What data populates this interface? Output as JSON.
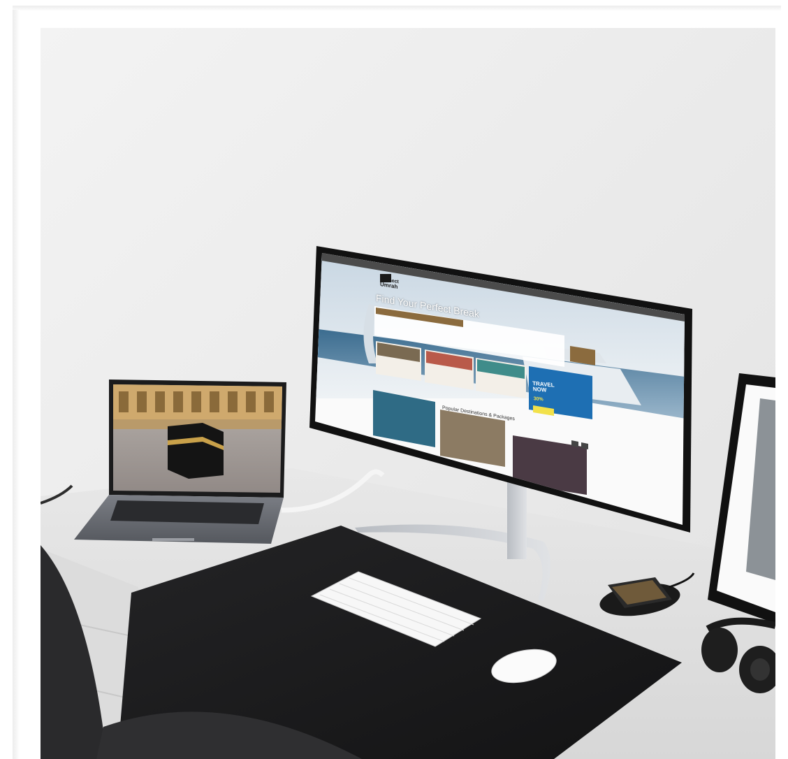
{
  "scene": {
    "description_colors": {
      "wall": "#ececec",
      "desk": "#e3e3e3",
      "desk_mat": "#1c1c1e",
      "monitor_bezel": "#111111",
      "laptop": "#6b6e75",
      "accent_brown": "#8b6b3e"
    }
  },
  "monitor_site": {
    "logo_line1": "connect",
    "logo_line2": "Umrah",
    "hero_heading": "Find Your Perfect Break",
    "section_heading": "Popular Destinations & Packages",
    "promo_line1": "TRAVEL",
    "promo_line2": "NOW",
    "promo_discount": "30%"
  },
  "laptop_screen": {
    "subject": "kaaba-makkah-photo"
  }
}
